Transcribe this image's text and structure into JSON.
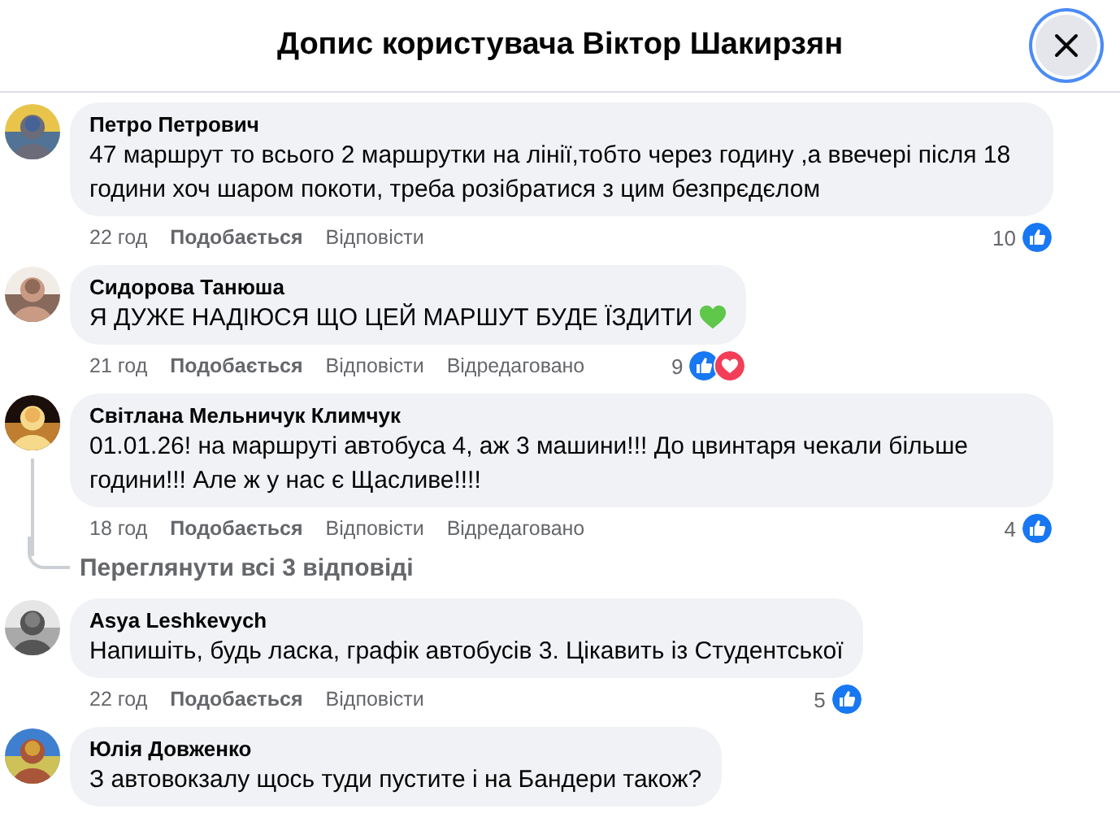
{
  "dialog": {
    "title": "Допис користувача Віктор Шакирзян",
    "close_focused": true
  },
  "comments": [
    {
      "author": "Петро Петрович",
      "text": "47 маршрут то всього 2 маршрутки на лінії,тобто через годину ,а ввечері після 18 години хоч шаром покоти, треба розібратися з цим безпрєдєлом",
      "emoji": false,
      "time": "22 год",
      "like": "Подобається",
      "reply": "Відповісти",
      "reactions": {
        "count": "10",
        "like": true,
        "love": false
      }
    },
    {
      "author": "Сидорова Танюша",
      "text": "Я ДУЖЕ НАДІЮСЯ ЩО ЦЕЙ МАРШУТ БУДЕ ЇЗДИТИ",
      "emoji": true,
      "time": "21 год",
      "like": "Подобається",
      "reply": "Відповісти",
      "edited": "Відредаговано",
      "reactions": {
        "count": "9",
        "like": true,
        "love": true
      }
    },
    {
      "author": "Світлана Мельничук Климчук",
      "text": "01.01.26! на маршруті автобуса 4, аж 3 машини!!! До цвинтаря чекали більше години!!! Але ж у нас є Щасливе!!!!",
      "emoji": false,
      "time": "18 год",
      "like": "Подобається",
      "reply": "Відповісти",
      "edited": "Відредаговано",
      "reactions": {
        "count": "4",
        "like": true,
        "love": false
      },
      "replies": "Переглянути всі 3 відповіді"
    },
    {
      "author": "Asya Leshkevych",
      "text": "Напишіть, будь ласка, графік автобусів 3. Цікавить із Студентської",
      "emoji": false,
      "time": "22 год",
      "like": "Подобається",
      "reply": "Відповісти",
      "reactions": {
        "count": "5",
        "like": true,
        "love": false
      }
    },
    {
      "author": "Юлія Довженко",
      "text": "З автовокзалу щось туди пустите і на Бандери також?",
      "emoji": false
    }
  ]
}
